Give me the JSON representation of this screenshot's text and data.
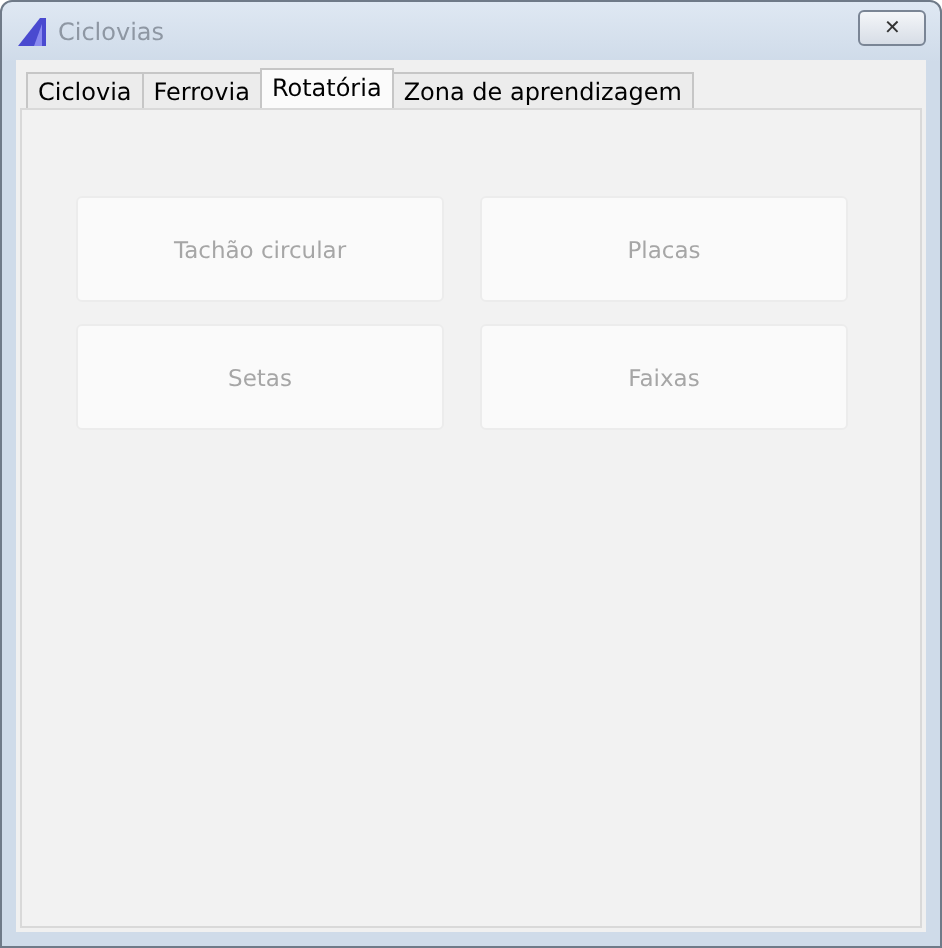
{
  "window": {
    "title": "Ciclovias",
    "close_label": "✕"
  },
  "tabs": [
    {
      "label": "Ciclovia",
      "selected": false
    },
    {
      "label": "Ferrovia",
      "selected": false
    },
    {
      "label": "Rotatória",
      "selected": true
    },
    {
      "label": "Zona de aprendizagem",
      "selected": false
    }
  ],
  "buttons": [
    "Tachão circular",
    "Placas",
    "Setas",
    "Faixas"
  ]
}
